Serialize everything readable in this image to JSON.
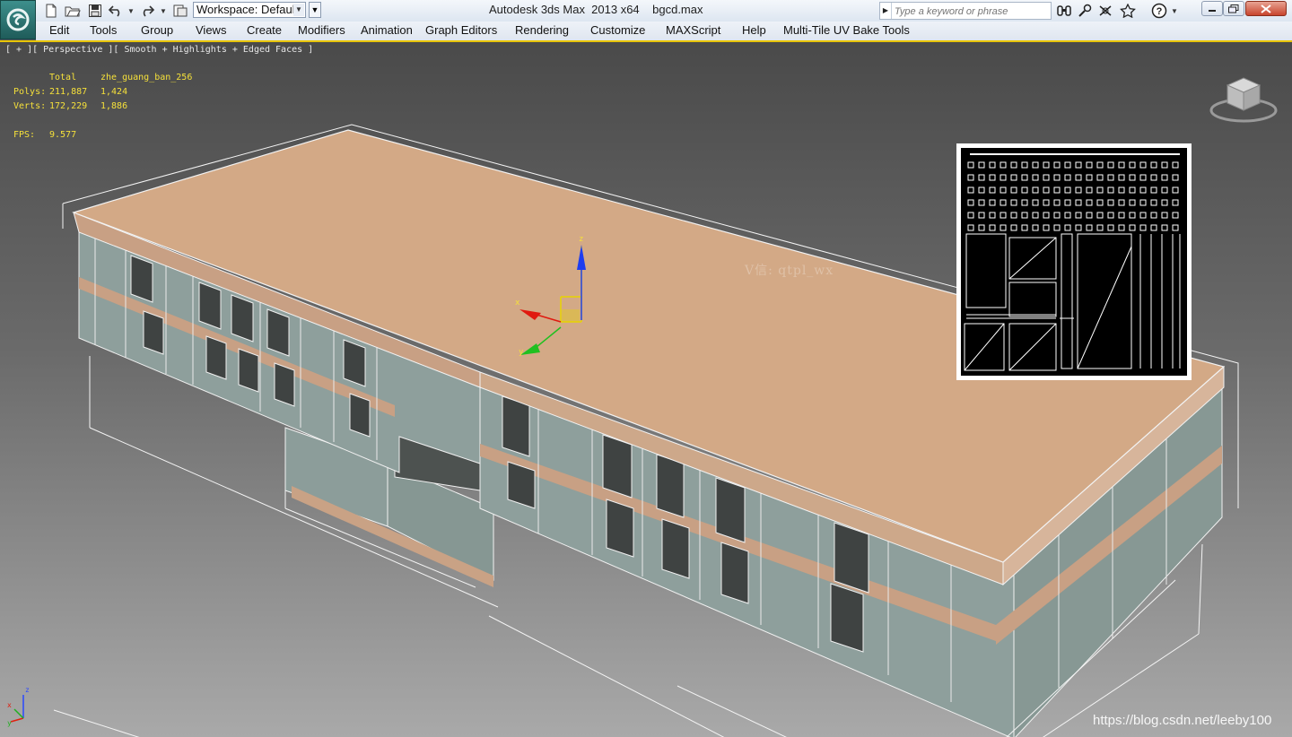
{
  "titlebar": {
    "app_name": "Autodesk 3ds Max  2013 x64",
    "file_name": "bgcd.max",
    "workspace_label": "Workspace: Default",
    "search_placeholder": "Type a keyword or phrase",
    "icons": [
      "new-file-icon",
      "open-folder-icon",
      "save-icon",
      "undo-icon",
      "redo-icon",
      "project-folder-icon",
      "binoculars-icon",
      "subscription-icon",
      "communication-icon",
      "favorites-star-icon",
      "help-icon"
    ]
  },
  "menu": {
    "items": [
      "Edit",
      "Tools",
      "Group",
      "Views",
      "Create",
      "Modifiers",
      "Animation",
      "Graph Editors",
      "Rendering",
      "Customize",
      "MAXScript",
      "Help",
      "Multi-Tile UV Bake Tools"
    ]
  },
  "viewport": {
    "label": "[ + ][ Perspective ][ Smooth + Highlights + Edged Faces ]",
    "stats": {
      "total_label": "Total",
      "object_name": "zhe_guang_ban_256",
      "polys_label": "Polys:",
      "polys_total": "211,887",
      "polys_object": "1,424",
      "verts_label": "Verts:",
      "verts_total": "172,229",
      "verts_object": "1,886",
      "fps_label": "FPS:",
      "fps_value": "9.577"
    },
    "gizmo_axes": [
      "x",
      "y",
      "z"
    ],
    "tripod_axes": [
      "x",
      "y",
      "z"
    ],
    "watermark_center": "V信: qtpl_wx",
    "watermark_corner": "https://blog.csdn.net/leeby100"
  },
  "colors": {
    "roof": "#d3a986",
    "glass": "#8c9d9a",
    "viewport_border_active": "#e8c400",
    "stats_text": "#f5e03a"
  }
}
